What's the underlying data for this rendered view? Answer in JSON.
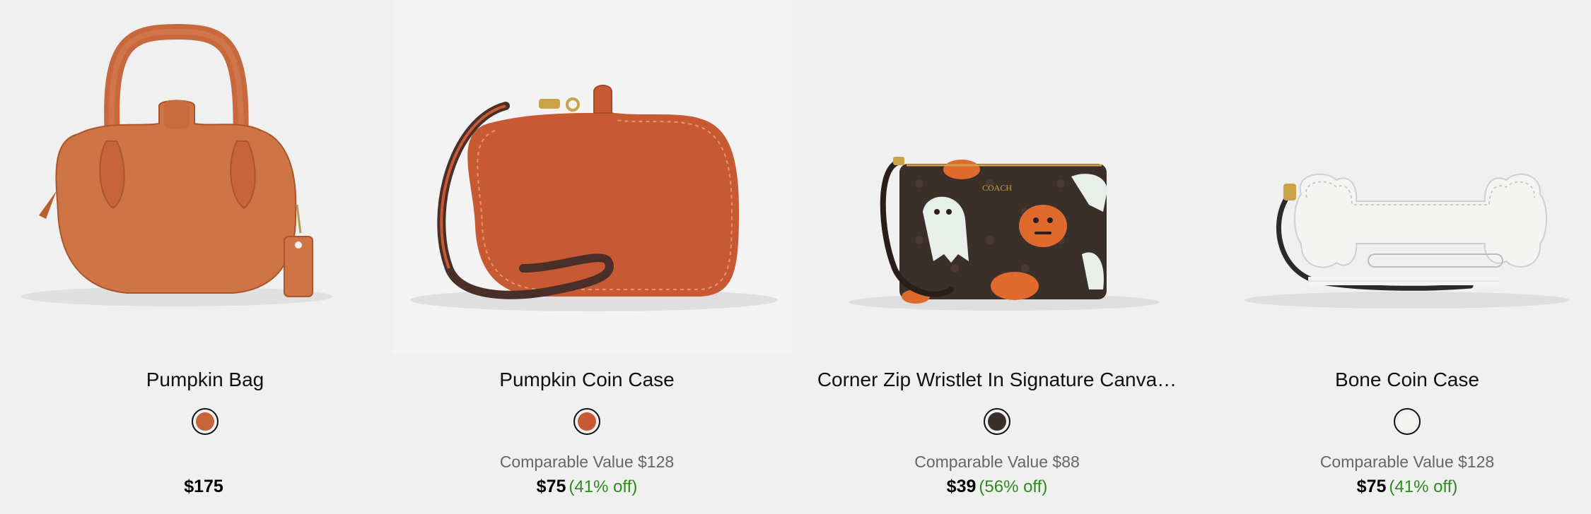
{
  "products": [
    {
      "title": "Pumpkin Bag",
      "swatch_color": "#c8643a",
      "swatch_name": "pumpkin-orange",
      "comparable": "",
      "price": "$175",
      "discount": ""
    },
    {
      "title": "Pumpkin Coin Case",
      "swatch_color": "#c85a33",
      "swatch_name": "pumpkin-orange",
      "comparable": "Comparable Value $128",
      "price": "$75",
      "discount": "(41% off)"
    },
    {
      "title": "Corner Zip Wristlet In Signature Canva…",
      "swatch_color": "#3a302b",
      "swatch_name": "dark-brown",
      "comparable": "Comparable Value $88",
      "price": "$39",
      "discount": "(56% off)"
    },
    {
      "title": "Bone Coin Case",
      "swatch_color": "#f4f4f2",
      "swatch_name": "chalk-white",
      "comparable": "Comparable Value $128",
      "price": "$75",
      "discount": "(41% off)"
    }
  ],
  "colors": {
    "background": "#f0f0f1",
    "discount_green": "#2e8a1f",
    "comparable_gray": "#666666"
  }
}
